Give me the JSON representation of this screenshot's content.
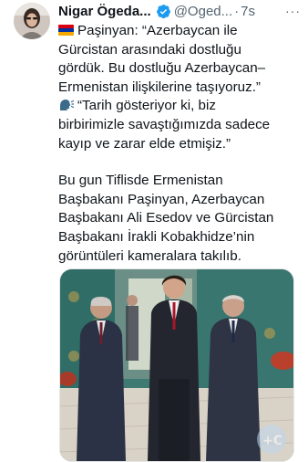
{
  "tweet": {
    "author_name": "Nigar Ögeda...",
    "handle": "@Oged...",
    "separator": "·",
    "time": "7s",
    "more_label": "···",
    "lines_block1": [
      "Paşinyan: “Azerbaycan ile",
      "Gürcistan arasındaki dostluğu",
      "gördük. Bu dostluğu Azerbaycan–",
      "Ermenistan ilişkilerine taşıyoruz.”",
      "“Tarih gösteriyor ki, biz",
      "birbirimizle savaştığımızda sadece",
      "kayıp ve zarar elde etmişiz.”"
    ],
    "lines_block2": [
      "Bu gun Tiflisde Ermenistan",
      "Başbakanı Paşinyan, Azerbaycan",
      "Başbakanı Ali Esedov ve Gürcistan",
      "Başbakanı İrakli Kobakhidze’nin",
      "görüntüleri kameralara takılıb."
    ]
  },
  "icons": {
    "flag": "armenia-flag-icon",
    "speaker": "speaking-head-icon",
    "verified": "verified-badge-icon",
    "more": "more-options-icon"
  },
  "colors": {
    "verified_blue": "#1d9bf0",
    "text": "#0f1419",
    "secondary": "#536471"
  }
}
